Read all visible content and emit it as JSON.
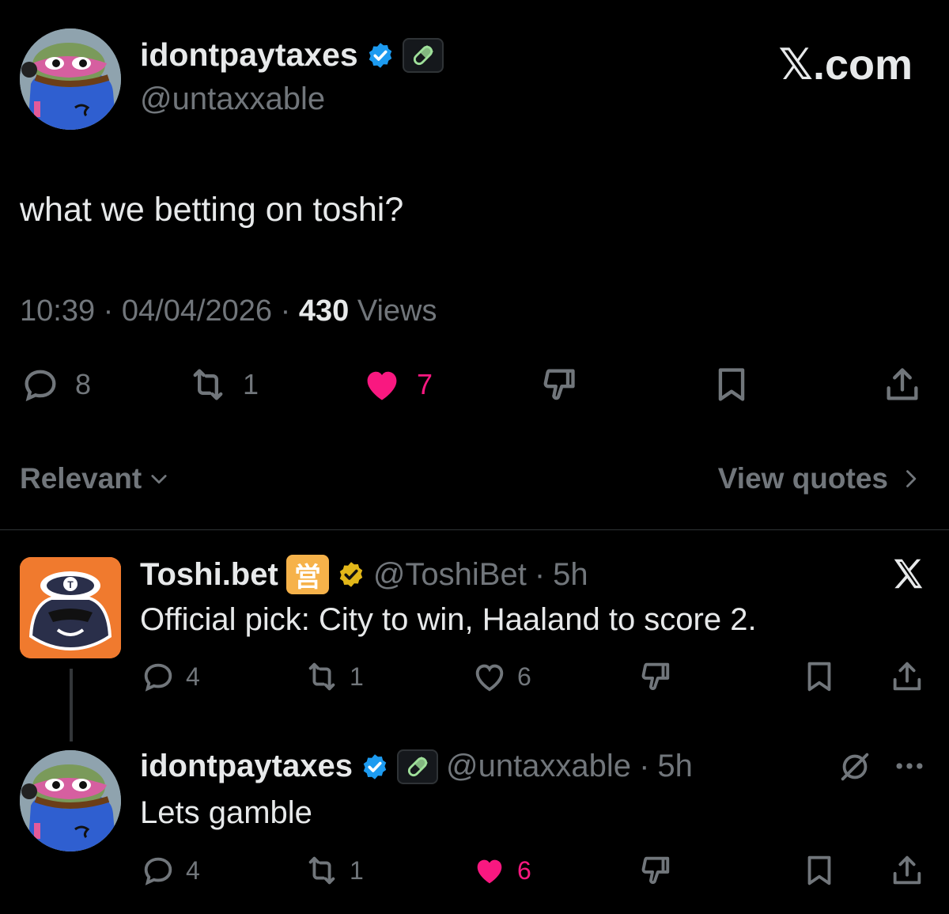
{
  "main_tweet": {
    "display_name": "idontpaytaxes",
    "handle": "@untaxxable",
    "watermark": "𝕏.com",
    "text": "what we betting on toshi?",
    "time": "10:39",
    "date": "04/04/2026",
    "sep1": "·",
    "sep2": "·",
    "views_count": "430",
    "views_label": "Views",
    "replies": "8",
    "reposts": "1",
    "likes": "7"
  },
  "sort": {
    "label": "Relevant"
  },
  "view_quotes": {
    "label": "View quotes"
  },
  "replies": [
    {
      "display_name": "Toshi.bet",
      "affiliate_badge": "営",
      "handle": "@ToshiBet",
      "sep": "·",
      "time": "5h",
      "text": "Official pick: City to win, Haaland to score 2.",
      "replies": "4",
      "reposts": "1",
      "likes": "6"
    },
    {
      "display_name": "idontpaytaxes",
      "handle": "@untaxxable",
      "sep": "·",
      "time": "5h",
      "text": "Lets gamble",
      "replies": "4",
      "reposts": "1",
      "likes": "6"
    }
  ],
  "colors": {
    "background": "#000000",
    "text": "#e7e9ea",
    "muted": "#71767b",
    "like_active": "#f91880",
    "verified_blue": "#1d9bf0",
    "verified_gold": "#e2b719",
    "toshi_orange": "#f07a2e"
  },
  "icons": [
    "reply-icon",
    "repost-icon",
    "heart-icon",
    "dislike-icon",
    "bookmark-icon",
    "share-icon",
    "verified-badge-icon",
    "pill-icon",
    "x-logo-icon",
    "mute-icon",
    "more-icon",
    "chevron-down-icon",
    "chevron-right-icon"
  ]
}
